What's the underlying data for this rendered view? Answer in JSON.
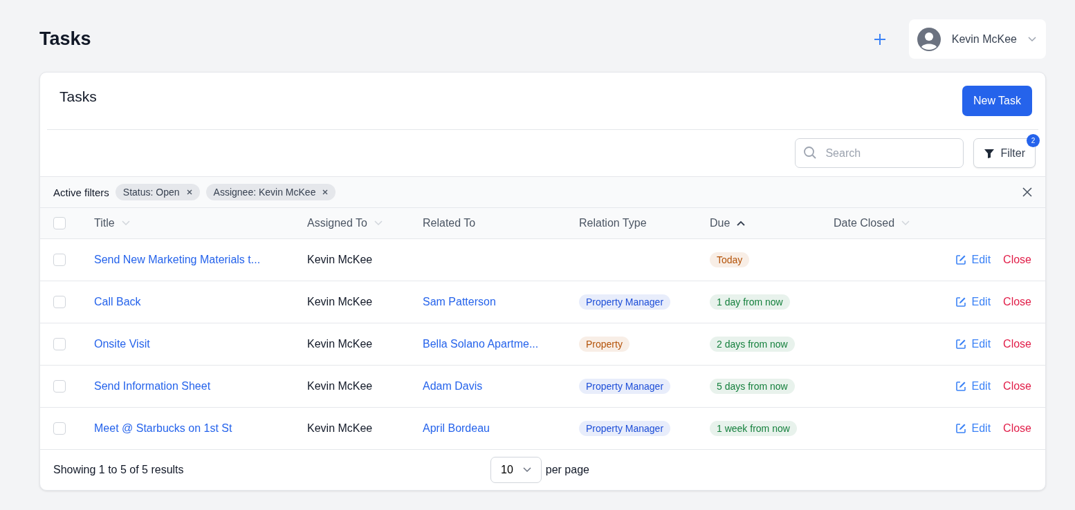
{
  "page": {
    "title": "Tasks",
    "user": {
      "name": "Kevin McKee"
    }
  },
  "card": {
    "title": "Tasks",
    "new_button": "New Task"
  },
  "toolbar": {
    "search": {
      "placeholder": "Search"
    },
    "filter": {
      "label": "Filter",
      "count": "2"
    }
  },
  "active_filters": {
    "label": "Active filters",
    "chips": [
      {
        "label": "Status: Open"
      },
      {
        "label": "Assignee: Kevin McKee"
      }
    ]
  },
  "table": {
    "select_all_checked": false,
    "columns": [
      {
        "label": "Title",
        "sorted": false
      },
      {
        "label": "Assigned To",
        "sorted": false
      },
      {
        "label": "Related To"
      },
      {
        "label": "Relation Type"
      },
      {
        "label": "Due",
        "sorted": true
      },
      {
        "label": "Date Closed",
        "sorted": false
      }
    ],
    "rows": [
      {
        "checked": false,
        "title": "Send New Marketing Materials t...",
        "assigned_to": "Kevin McKee",
        "due": {
          "label": "Today",
          "color": "#b45309"
        },
        "edit": "Edit",
        "close": "Close"
      },
      {
        "checked": false,
        "title": "Call Back",
        "assigned_to": "Kevin McKee",
        "related_to": "Sam Patterson",
        "relation_type": {
          "label": "Property Manager",
          "color": "#1d4ed8"
        },
        "due": {
          "label": "1 day from now",
          "color": "#15803d"
        },
        "edit": "Edit",
        "close": "Close"
      },
      {
        "checked": false,
        "title": "Onsite Visit",
        "assigned_to": "Kevin McKee",
        "related_to": "Bella Solano Apartme...",
        "relation_type": {
          "label": "Property",
          "color": "#b45309"
        },
        "due": {
          "label": "2 days from now",
          "color": "#15803d"
        },
        "edit": "Edit",
        "close": "Close"
      },
      {
        "checked": false,
        "title": "Send Information Sheet",
        "assigned_to": "Kevin McKee",
        "related_to": "Adam Davis",
        "relation_type": {
          "label": "Property Manager",
          "color": "#1d4ed8"
        },
        "due": {
          "label": "5 days from now",
          "color": "#15803d"
        },
        "edit": "Edit",
        "close": "Close"
      },
      {
        "checked": false,
        "title": "Meet @ Starbucks on 1st St",
        "assigned_to": "Kevin McKee",
        "related_to": "April Bordeau",
        "relation_type": {
          "label": "Property Manager",
          "color": "#1d4ed8"
        },
        "due": {
          "label": "1 week from now",
          "color": "#15803d"
        },
        "edit": "Edit",
        "close": "Close"
      }
    ]
  },
  "footer": {
    "summary": "Showing 1 to 5 of 5 results",
    "page_size": "10",
    "per_page_label": "per page"
  }
}
